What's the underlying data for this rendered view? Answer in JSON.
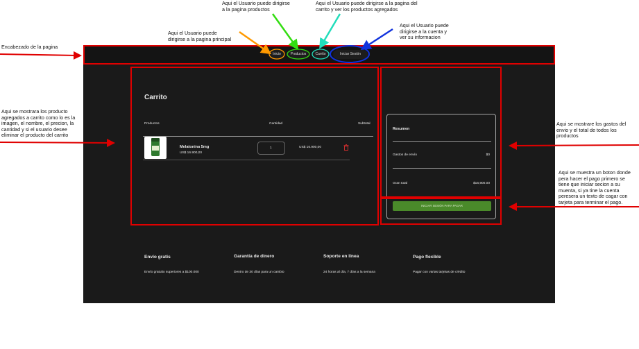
{
  "annotations": {
    "header": "Encabezado de la pagina",
    "home": "Aqui el Usuario puede\ndirigirse a la pagina principal",
    "products": "Aqui el Usuario puede dirigirse\na la pagina productos",
    "cart": "Aqui el Usuario puede dirigirse a la pagina del\ncarrito y ver los productos agregados",
    "account": "Aqui el Usuario puede\ndirigirse a la cuenta y\nver su informacion",
    "cart_items": "Aqui se mostrara los producto\nagregados a carrito como lo es la\nimagen, el nombre, el precion, la\ncantidad y si el usuario desee\neliminar el producto del carrito",
    "summary": "Aqui se mostrare los gastos del\nenvio y el total de todos los\nproductos",
    "pay_button": "Aqui se muestra un boton donde\npera hacer el pago primero se\ntiene que iniciar secion a su\nmuenta, si ya tine la cuenta\nperesera un texto de cagar con\ntarjeta para terminar el pago."
  },
  "nav": {
    "inicio": "Inicio",
    "productos": "Productos",
    "carrito": "Carrito",
    "iniciar_sesion": "Iniciar Sesión"
  },
  "cart": {
    "title": "Carrito",
    "columns": {
      "product": "Productos",
      "quantity": "Cantidad",
      "subtotal": "Subtotal"
    },
    "item": {
      "name": "Melatonina 5mg",
      "price": "US$ 16.900,00",
      "quantity": "1",
      "subtotal": "US$ 16.900,00"
    }
  },
  "summary": {
    "title": "Resumen",
    "shipping_label": "Gastos de envío",
    "shipping_value": "$0",
    "total_label": "Gran total",
    "total_value": "$16,900.00",
    "button_label": "INICIAR SESIÓN PARA PAGAR"
  },
  "features": [
    {
      "title": "Envío gratis",
      "text": "Envío gratuito superiores a $100.000"
    },
    {
      "title": "Garantía de dinero",
      "text": "Dentro de 30 días para un cambio"
    },
    {
      "title": "Soporte en línea",
      "text": "24 horas al día, 7 días a la semana"
    },
    {
      "title": "Pago flexible",
      "text": "Pagar con varias tarjetas de crédito"
    }
  ],
  "colors": {
    "red": "#e00000",
    "orange": "#ff9900",
    "green": "#33dd11",
    "teal": "#22ddbb",
    "blue": "#1133dd",
    "pay_button": "#4a8a2a"
  }
}
